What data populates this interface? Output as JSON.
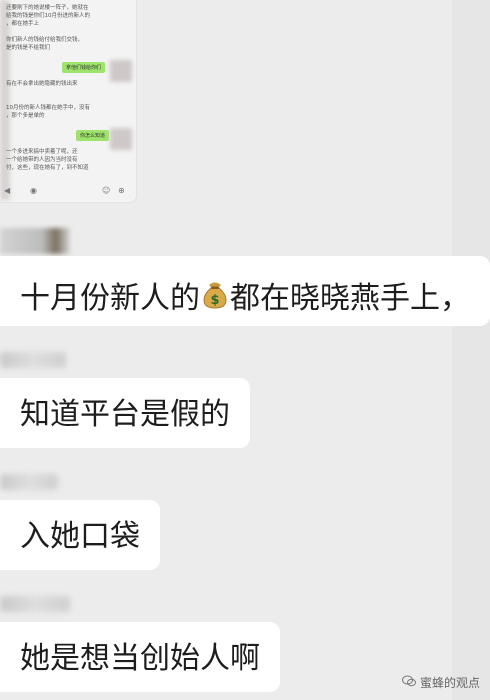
{
  "embedded_screenshot": {
    "lines": [
      "还要刷下的她说楼一阵子，她就在",
      "给我的钱是你们10月份进的新人的",
      "，都在她手上",
      "你们新人的钱给付给我们交钱，",
      "是的钱是不给我们",
      "有在不会拿出她隐藏的钱出来",
      "10月份的新人钱都在她手中，没有",
      "，那个多是单的",
      "一个多进来搞中卖着了呢，还",
      "一个给她带的人因为当时没有",
      "付，这些，现在她有了，到不知道"
    ],
    "green_1": "拿他们钱给你们",
    "green_2": "你怎么知道"
  },
  "messages": [
    {
      "text_before": "十月份新人的",
      "icon": "money-bag",
      "text_after": "都在晓晓燕手上，"
    },
    {
      "text": "知道平台是假的"
    },
    {
      "text": "入她口袋"
    },
    {
      "text": "她是想当创始人啊"
    }
  ],
  "watermark": {
    "text": "蜜蜂的观点"
  }
}
